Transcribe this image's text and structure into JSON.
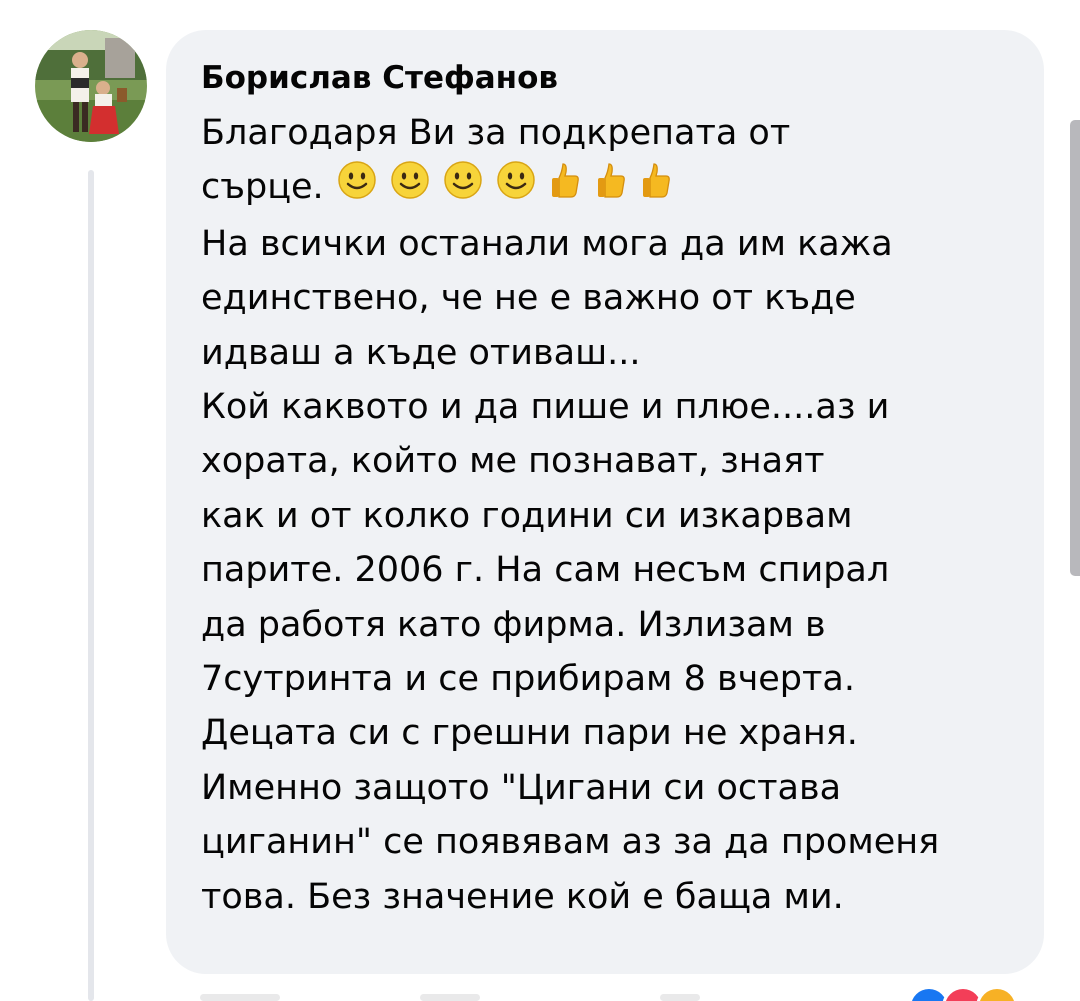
{
  "comment": {
    "author": "Борислав Стефанов",
    "lines": [
      "Благодаря Ви за подкрепата от",
      "сърце.",
      "На всички останали мога да им кажа",
      "единствено, че  не е важно от къде",
      "идваш а къде отиваш...",
      "Кой каквото и да пише и плюе....аз и",
      "хората,  който ме познават, знаят",
      "как и от колко години си изкарвам",
      "парите. 2006 г. На сам несъм спирал",
      "да работя като фирма. Излизам в",
      "7сутринта и се прибирам 8 вчерта.",
      "Децата си с грешни пари не храня.",
      "Именно защото \"Цигани си остава",
      "циганин\" се появявам аз за да променя",
      "това. Без значение кой е баща ми."
    ],
    "emojis": [
      "smiling-face",
      "smiling-face",
      "smiling-face",
      "smiling-face",
      "thumbs-up",
      "thumbs-up",
      "thumbs-up"
    ]
  },
  "colors": {
    "bubble": "#f0f2f5",
    "text": "#050505",
    "thread_line": "#e4e6eb",
    "like_blue": "#1877f2",
    "love_red": "#f33e58",
    "haha_yellow": "#f7b125"
  },
  "reactions": [
    "like",
    "love",
    "haha"
  ]
}
